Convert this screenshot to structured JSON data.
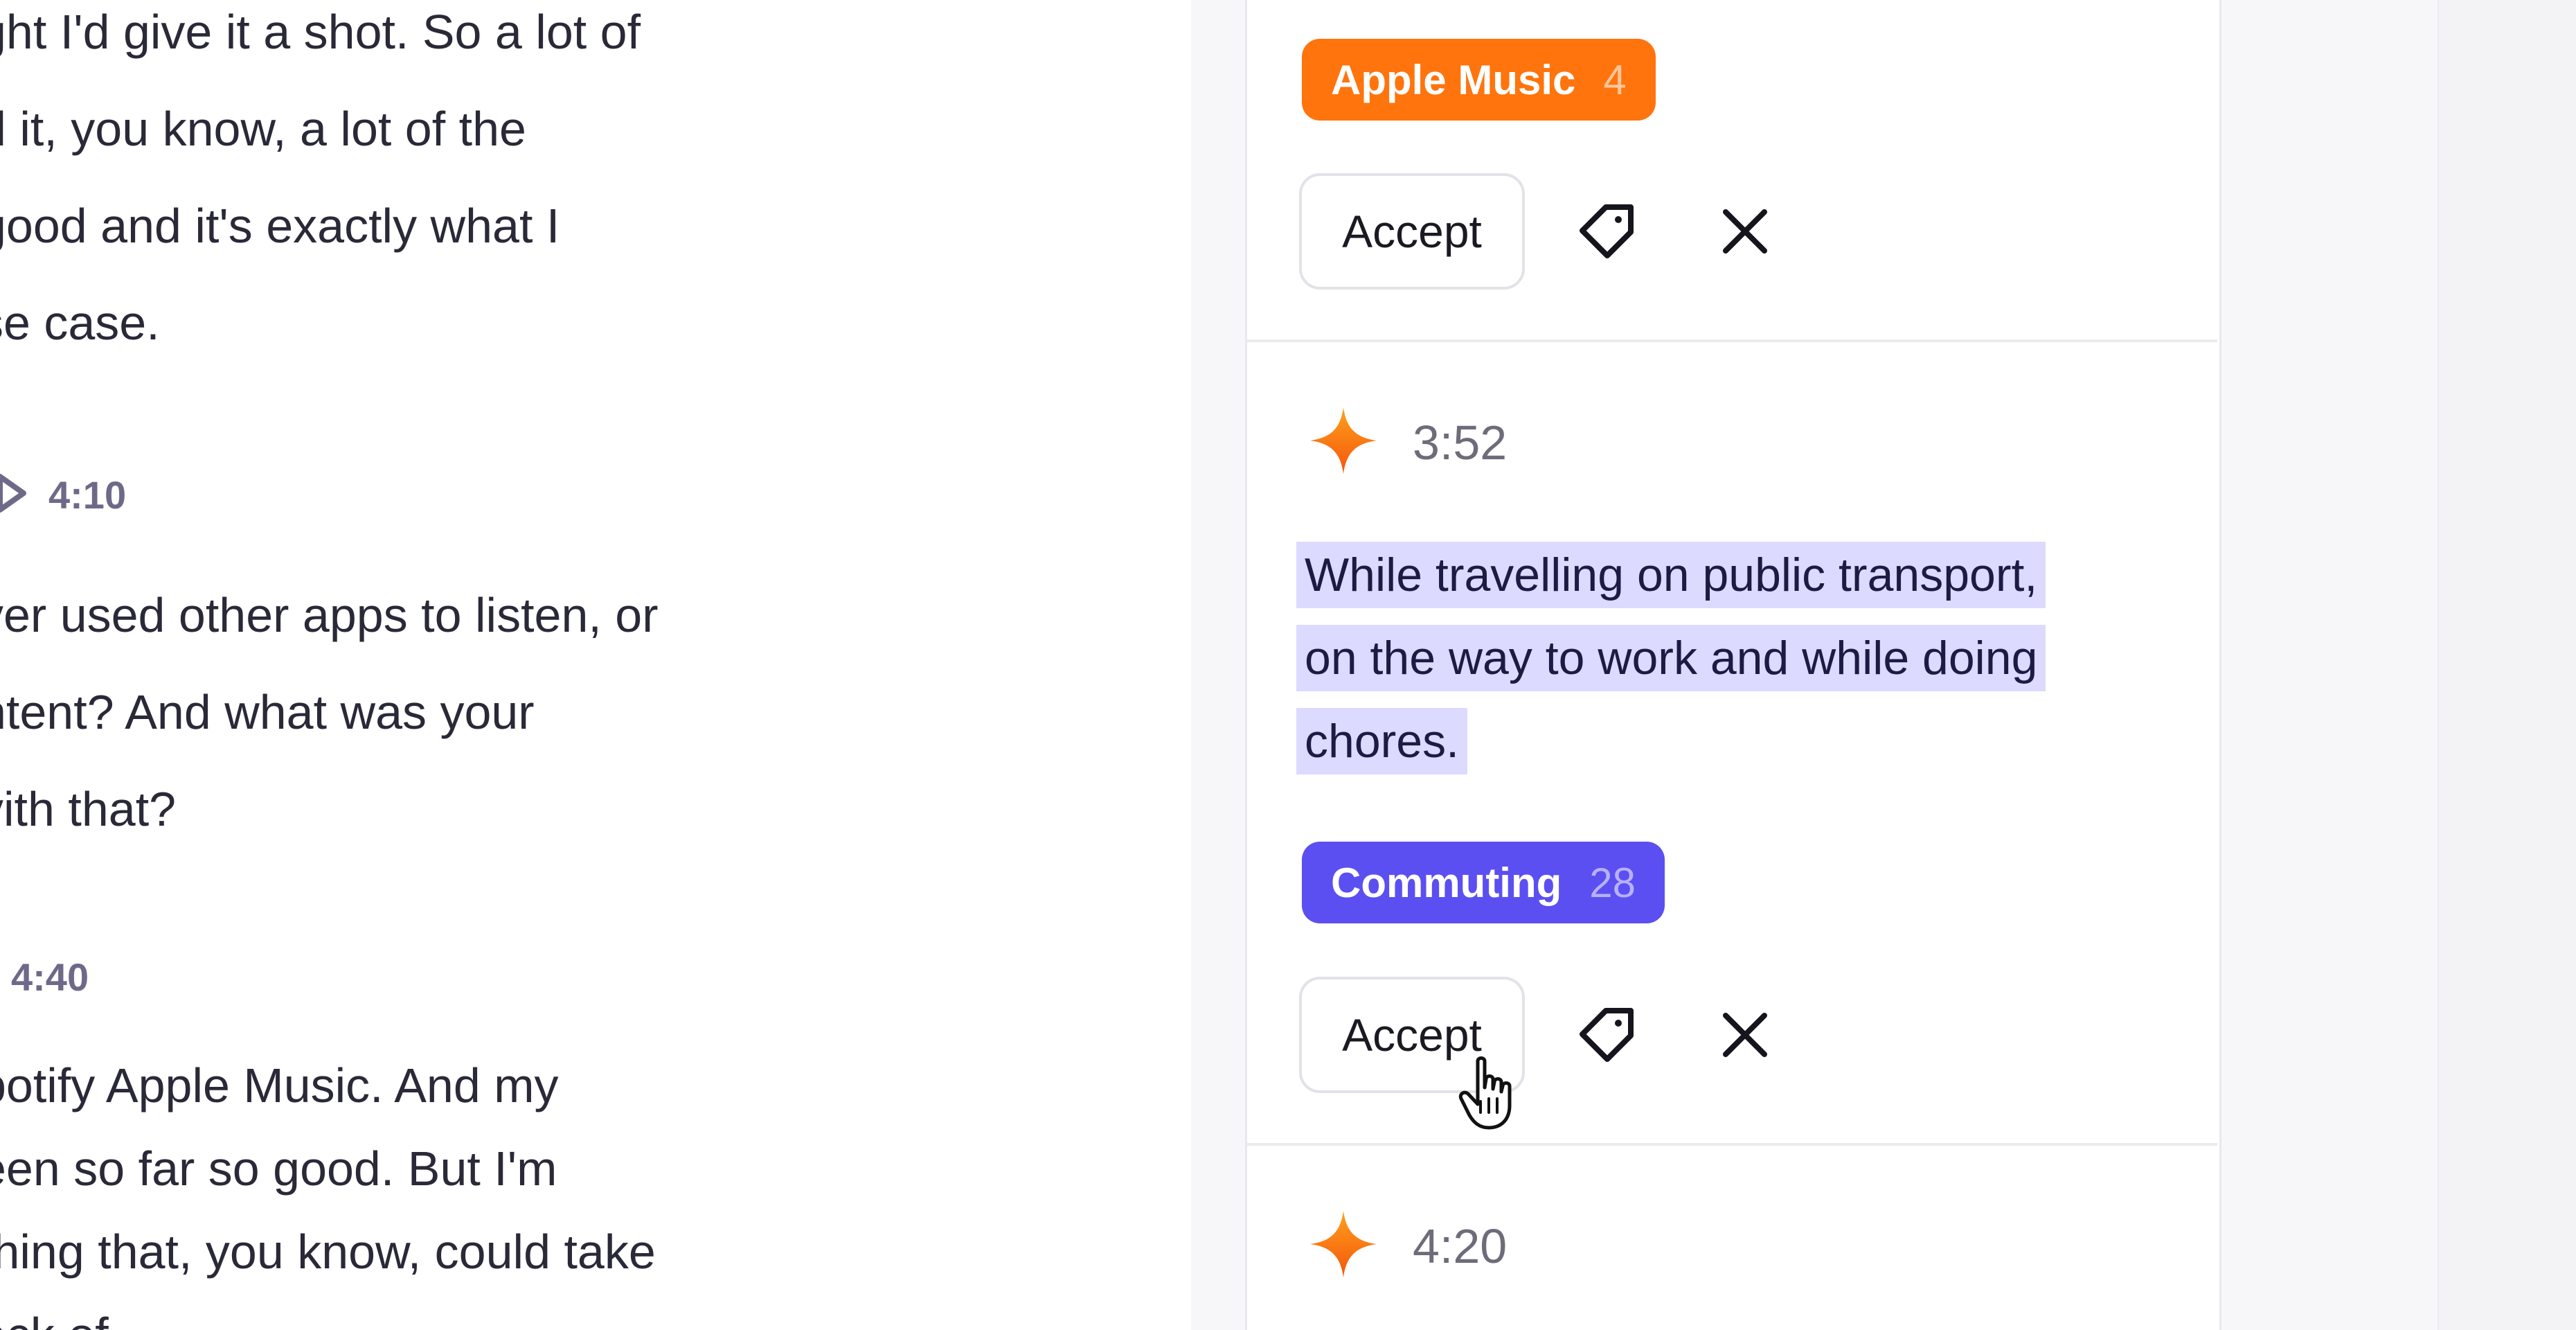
{
  "transcript": {
    "block1": [
      "ght I'd give it a shot. So a lot of",
      "d it, you know, a lot of the",
      " good and it's exactly what I",
      "se case."
    ],
    "speaker2": {
      "time": "4:10",
      "icon": "play-icon"
    },
    "block2": [
      "ver used other apps to listen, or",
      "ntent? And what was your",
      "vith that?"
    ],
    "speaker3": {
      "time": "4:40"
    },
    "block3": [
      "potify Apple Music. And my",
      "een so far so good. But I'm",
      "thing that, you know, could take",
      "ack of ..."
    ]
  },
  "suggestions": [
    {
      "tag": {
        "label": "Apple Music",
        "count": "4",
        "color": "#ff740d"
      },
      "accept_label": "Accept"
    },
    {
      "timestamp": "3:52",
      "icon": "sparkle-icon",
      "highlight": [
        "While travelling on public transport,",
        "on the way to work and while doing",
        "chores."
      ],
      "tag": {
        "label": "Commuting",
        "count": "28",
        "color": "#5b4ff2"
      },
      "accept_label": "Accept"
    },
    {
      "timestamp": "4:20",
      "icon": "sparkle-icon"
    }
  ],
  "icons": {
    "tag": "tag-icon",
    "close": "close-icon",
    "cursor": "hand-pointer-cursor"
  },
  "colors": {
    "accent": "#5b4ff2",
    "highlight": "#dcdaff",
    "orange": "#ff740d"
  }
}
